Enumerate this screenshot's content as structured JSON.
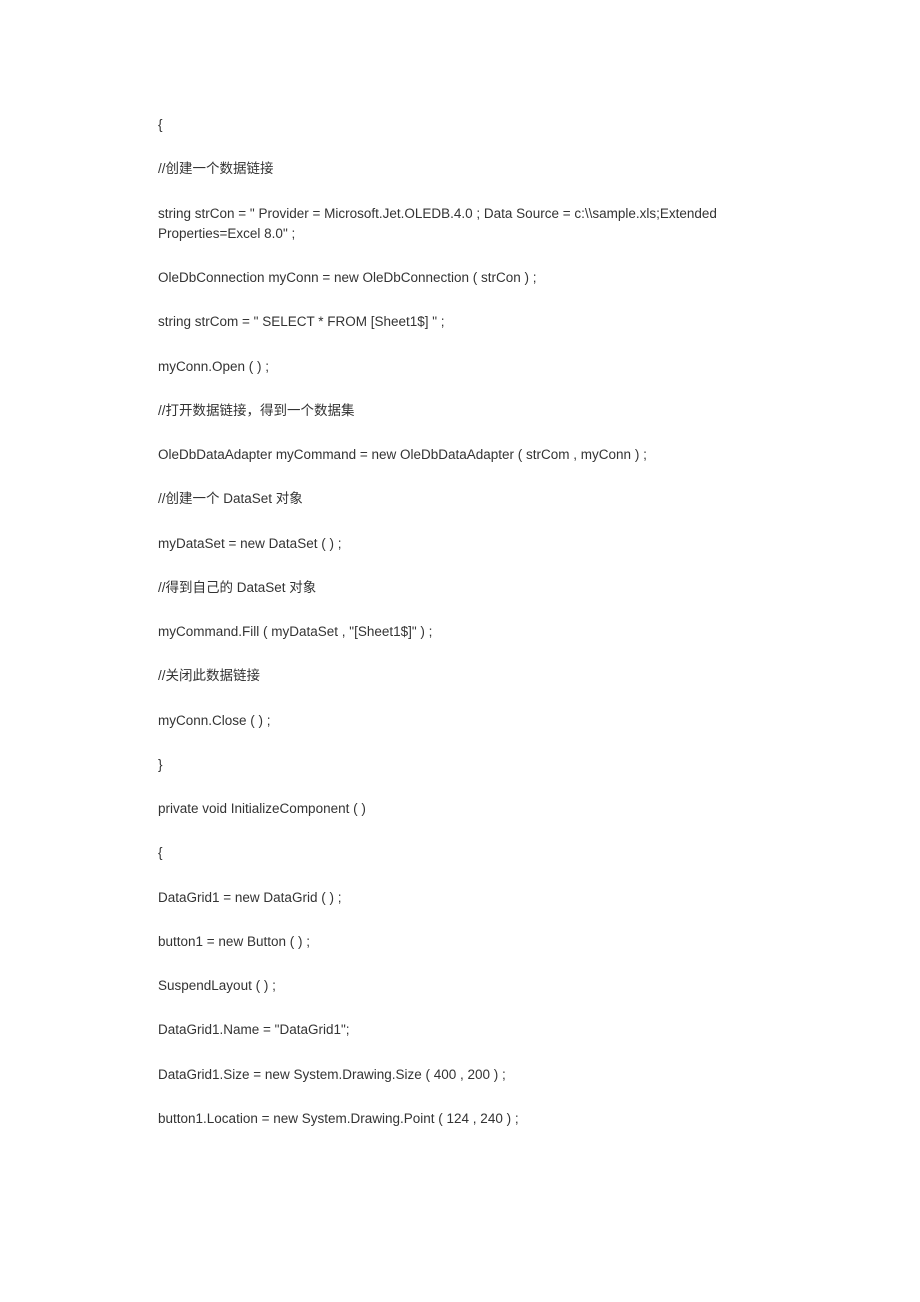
{
  "lines": [
    "{",
    "//创建一个数据链接",
    "string strCon = \" Provider = Microsoft.Jet.OLEDB.4.0 ; Data Source = c:\\\\sample.xls;Extended Properties=Excel 8.0\" ;",
    "OleDbConnection myConn = new OleDbConnection ( strCon ) ;",
    "string strCom = \" SELECT * FROM [Sheet1$] \" ;",
    "myConn.Open ( ) ;",
    "//打开数据链接，得到一个数据集",
    "OleDbDataAdapter myCommand = new OleDbDataAdapter ( strCom , myConn ) ;",
    "//创建一个 DataSet 对象",
    "myDataSet = new DataSet ( ) ;",
    "//得到自己的 DataSet 对象",
    "myCommand.Fill ( myDataSet , \"[Sheet1$]\" ) ;",
    "//关闭此数据链接",
    "myConn.Close ( ) ;",
    "}",
    "private void InitializeComponent ( )",
    "{",
    "DataGrid1 = new DataGrid ( ) ;",
    "button1 = new Button ( ) ;",
    "SuspendLayout ( ) ;",
    "DataGrid1.Name = \"DataGrid1\";",
    "DataGrid1.Size = new System.Drawing.Size ( 400 , 200 ) ;",
    "button1.Location = new System.Drawing.Point ( 124 , 240 ) ;"
  ]
}
